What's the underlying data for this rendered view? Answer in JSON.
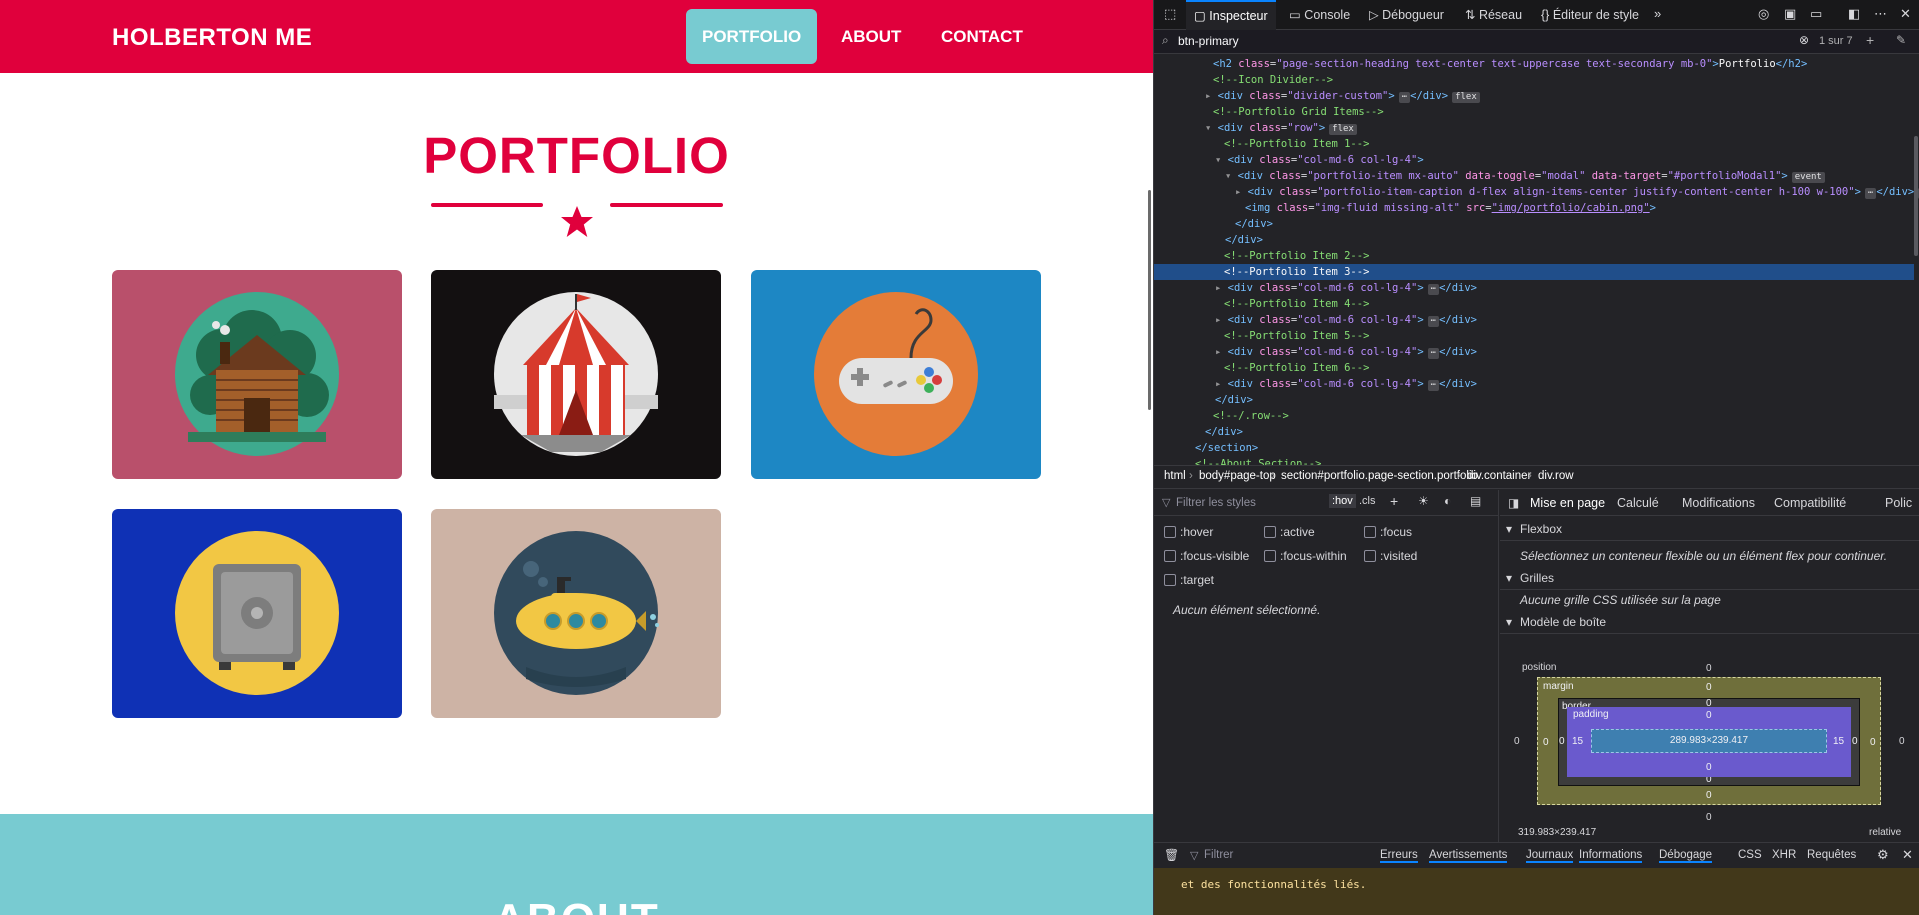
{
  "site": {
    "brand": "HOLBERTON ME",
    "nav": [
      {
        "label": "PORTFOLIO",
        "active": true
      },
      {
        "label": "ABOUT",
        "active": false
      },
      {
        "label": "CONTACT",
        "active": false
      }
    ],
    "section_title": "PORTFOLIO",
    "portfolio": [
      {
        "name": "cabin",
        "bg": "#b9506b"
      },
      {
        "name": "circus-tent",
        "bg": "#131011"
      },
      {
        "name": "game-controller",
        "bg": "#1d87c4"
      },
      {
        "name": "safe",
        "bg": "#0f31b5"
      },
      {
        "name": "submarine",
        "bg": "#cdb3a5"
      }
    ],
    "next_section_title": "ABOUT",
    "colors": {
      "primary": "#e0003c",
      "secondary": "#78cbd1"
    }
  },
  "devtools": {
    "tabs": [
      "Inspecteur",
      "Console",
      "Débogueur",
      "Réseau",
      "Éditeur de style"
    ],
    "search": {
      "value": "btn-primary",
      "count": "1 sur 7"
    },
    "breadcrumbs": [
      "html",
      "body#page-top",
      "section#portfolio.page-section.portfolio",
      "div.container",
      "div.row"
    ],
    "rules": {
      "filter_placeholder": "Filtrer les styles",
      "hov": ":hov",
      "cls": ".cls",
      "pseudo": [
        ":hover",
        ":active",
        ":focus",
        ":focus-visible",
        ":focus-within",
        ":visited",
        ":target"
      ],
      "empty": "Aucun élément sélectionné."
    },
    "layout_tabs": [
      "Mise en page",
      "Calculé",
      "Modifications",
      "Compatibilité",
      "Polic"
    ],
    "flexbox": {
      "title": "Flexbox",
      "msg": "Sélectionnez un conteneur flexible ou un élément flex pour continuer."
    },
    "grids": {
      "title": "Grilles",
      "msg": "Aucune grille CSS utilisée sur la page"
    },
    "box_model": {
      "title": "Modèle de boîte",
      "position_label": "position",
      "margin_label": "margin",
      "border_label": "border",
      "padding_label": "padding",
      "content_size": "289.983×239.417",
      "position": "0",
      "margin": "0",
      "border": "0",
      "padding_lr": "15",
      "padding_tb": "0",
      "outer_left": "0",
      "outer_right": "0",
      "footer_size": "319.983×239.417",
      "footer_pos": "relative"
    },
    "console": {
      "filter": "Filtrer",
      "buttons": [
        "Erreurs",
        "Avertissements",
        "Journaux",
        "Informations",
        "Débogage",
        "CSS",
        "XHR",
        "Requêtes"
      ],
      "message": "et des fonctionnalités liés."
    }
  }
}
